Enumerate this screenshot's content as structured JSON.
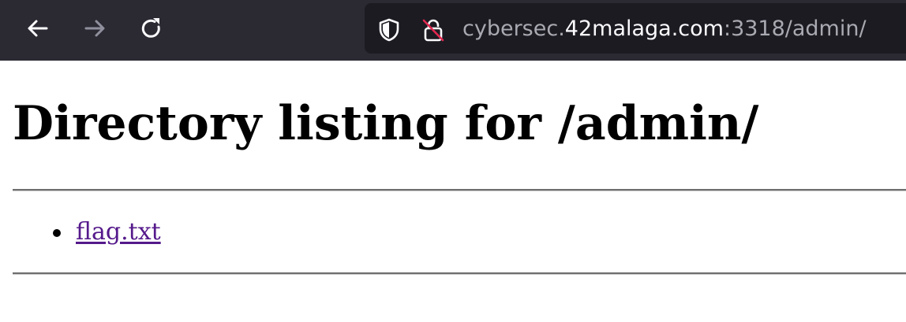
{
  "browser": {
    "url_prefix": "cybersec.",
    "url_domain": "42malaga.com",
    "url_suffix": ":3318/admin/"
  },
  "page": {
    "heading": "Directory listing for /admin/",
    "files": [
      {
        "name": "flag.txt"
      }
    ]
  },
  "colors": {
    "toolbar_bg": "#2b2a33",
    "urlbar_bg": "#1c1b22",
    "visited_link": "#551a8b"
  }
}
